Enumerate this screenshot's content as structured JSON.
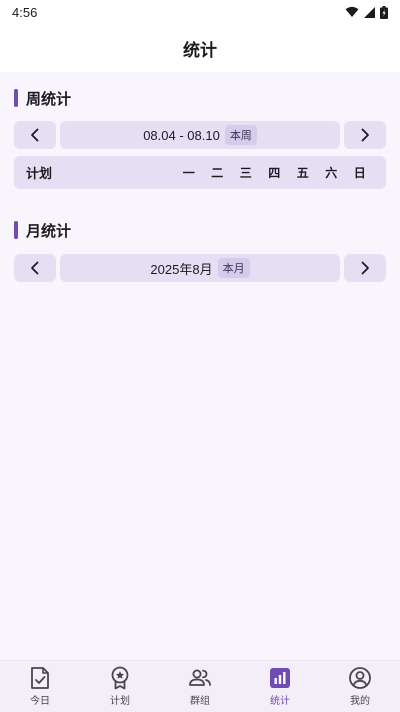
{
  "status_bar": {
    "time": "4:56"
  },
  "app_bar": {
    "title": "统计"
  },
  "weekly": {
    "title": "周统计",
    "range": "08.04 - 08.10",
    "badge": "本周",
    "plan_label": "计划",
    "weekdays": [
      "一",
      "二",
      "三",
      "四",
      "五",
      "六",
      "日"
    ]
  },
  "monthly": {
    "title": "月统计",
    "range": "2025年8月",
    "badge": "本月"
  },
  "bottom_nav": {
    "items": [
      {
        "label": "今日",
        "icon": "today-check-icon"
      },
      {
        "label": "计划",
        "icon": "award-badge-icon"
      },
      {
        "label": "群组",
        "icon": "group-people-icon"
      },
      {
        "label": "统计",
        "icon": "bar-chart-icon",
        "active": true
      },
      {
        "label": "我的",
        "icon": "profile-icon"
      }
    ]
  },
  "colors": {
    "accent": "#6e4cb1",
    "surface": "#e6dff4",
    "background": "#f8f5fc"
  }
}
